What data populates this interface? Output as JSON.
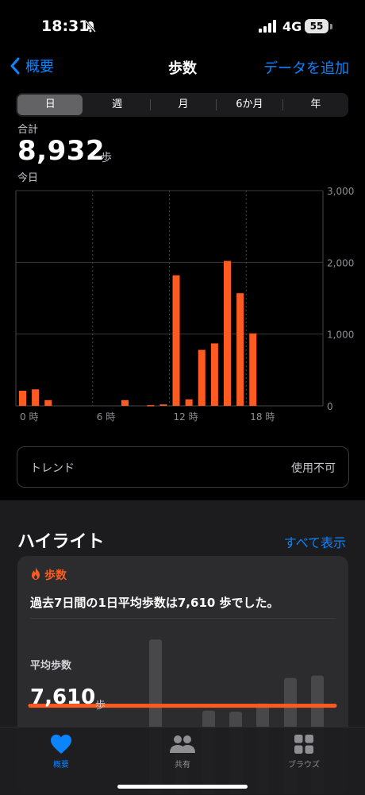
{
  "status": {
    "time": "18:31",
    "network": "4G",
    "battery": "55"
  },
  "nav": {
    "back_label": "概要",
    "title": "歩数",
    "add_label": "データを追加"
  },
  "segments": [
    "日",
    "週",
    "月",
    "6か月",
    "年"
  ],
  "summary": {
    "label": "合計",
    "value": "8,932",
    "unit": "歩",
    "date": "今日"
  },
  "chart_data": {
    "type": "bar",
    "x": [
      0,
      1,
      2,
      3,
      4,
      5,
      6,
      7,
      8,
      9,
      10,
      11,
      12,
      13,
      14,
      15,
      16,
      17,
      18,
      19,
      20,
      21,
      22,
      23
    ],
    "values": [
      210,
      230,
      80,
      0,
      0,
      0,
      0,
      0,
      80,
      0,
      10,
      20,
      1820,
      90,
      780,
      870,
      2020,
      1570,
      1010,
      0,
      0,
      0,
      0,
      0
    ],
    "xticks": [
      "0 時",
      "6 時",
      "12 時",
      "18 時"
    ],
    "yticks": [
      "3,000",
      "2,000",
      "1,000",
      "0"
    ],
    "ylim": [
      0,
      3000
    ],
    "color": "#ff5a1f"
  },
  "trend": {
    "label": "トレンド",
    "value": "使用不可"
  },
  "highlights": {
    "title": "ハイライト",
    "show_all": "すべて表示",
    "card": {
      "category": "歩数",
      "text": "過去7日間の1日平均歩数は7,610 歩でした。",
      "avg_label": "平均歩数",
      "avg_value": "7,610",
      "avg_unit": "歩",
      "week_values": [
        13300,
        3800,
        7200,
        7100,
        7800,
        10000,
        10200
      ],
      "average": 7610,
      "line_color": "#ff5a1f"
    }
  },
  "tabs": [
    {
      "label": "概要",
      "icon": "heart-icon",
      "active": true
    },
    {
      "label": "共有",
      "icon": "people-icon",
      "active": false
    },
    {
      "label": "ブラウズ",
      "icon": "grid-icon",
      "active": false
    }
  ]
}
